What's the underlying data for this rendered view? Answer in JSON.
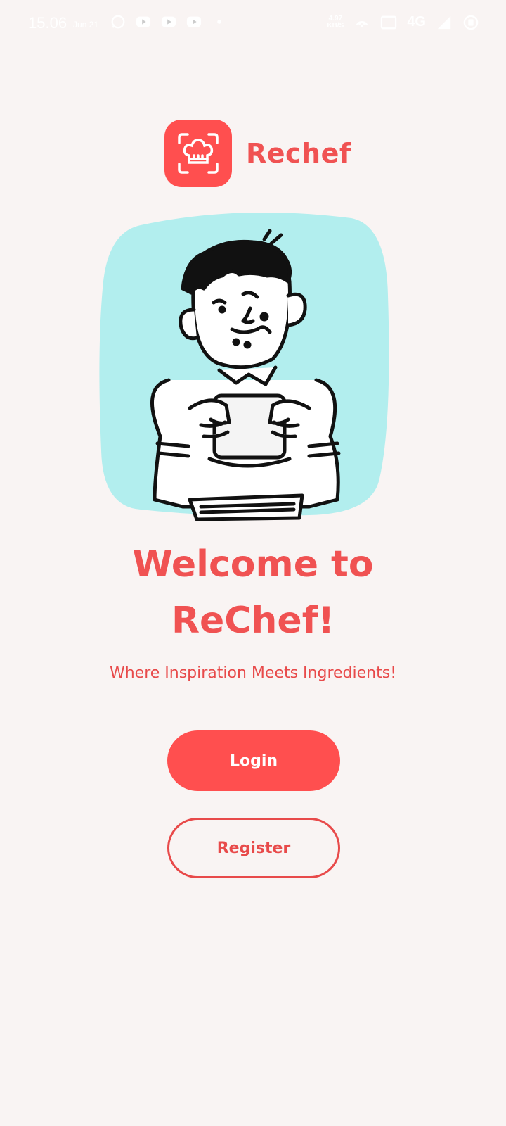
{
  "status_bar": {
    "time": "15.06",
    "date": "Jun 21",
    "network_type": "4G",
    "speed_value": "4.97",
    "speed_unit": "KB/S",
    "icons": [
      "whatsapp-icon",
      "youtube-icon",
      "youtube-icon",
      "youtube-icon",
      "dot-icon",
      "speed-icon",
      "hotspot-icon",
      "volte-icon",
      "signal-icon",
      "battery-icon"
    ]
  },
  "brand": {
    "name": "Rechef",
    "logo_icon": "chef-hat-scan-icon"
  },
  "hero": {
    "illustration": "person-eating-sandwich",
    "bg_color": "#b2eeee"
  },
  "welcome": {
    "line1": "Welcome to",
    "line2": "ReChef!"
  },
  "tagline": "Where Inspiration Meets Ingredients!",
  "buttons": {
    "login": "Login",
    "register": "Register"
  },
  "colors": {
    "accent": "#ff4f4f",
    "text_accent": "#f05252",
    "background": "#f9f4f3"
  }
}
